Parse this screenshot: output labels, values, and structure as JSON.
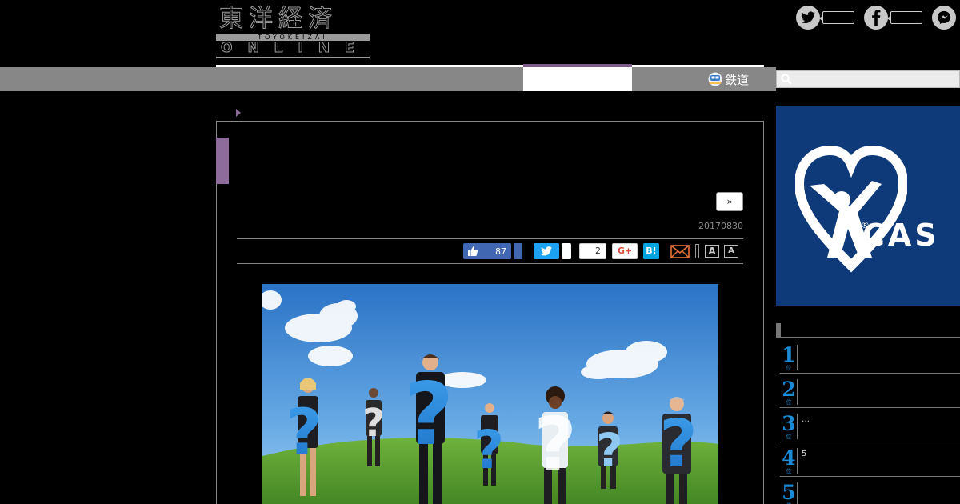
{
  "header": {
    "logo_kanji": "東洋経済",
    "logo_band": "TOYOKEIZAI",
    "logo_online": "ONLINE"
  },
  "social_top": [
    {
      "icon": "twitter-icon"
    },
    {
      "icon": "facebook-icon"
    },
    {
      "icon": "messenger-icon"
    }
  ],
  "nav": {
    "rail_label": "鉄道",
    "search_placeholder": ""
  },
  "article": {
    "next_label": "»",
    "date": "20170830",
    "share": {
      "like_count": "87",
      "hatena_count": "2",
      "gplus_label": "G+",
      "hatena_label": "B!",
      "font_big": "A",
      "font_small": "A"
    }
  },
  "sidebar": {
    "ad_text": "CAS",
    "ranking": [
      {
        "num": "1",
        "suffix": "位",
        "title": ""
      },
      {
        "num": "2",
        "suffix": "位",
        "title": ""
      },
      {
        "num": "3",
        "suffix": "位",
        "title": "…"
      },
      {
        "num": "4",
        "suffix": "位",
        "title": "5"
      },
      {
        "num": "5",
        "suffix": "位",
        "title": ""
      }
    ]
  },
  "colors": {
    "accent_purple": "#8d6b9b",
    "nav_gray": "#878787",
    "ad_blue": "#0f3a7a",
    "rank_blue": "#1a8ad4"
  }
}
